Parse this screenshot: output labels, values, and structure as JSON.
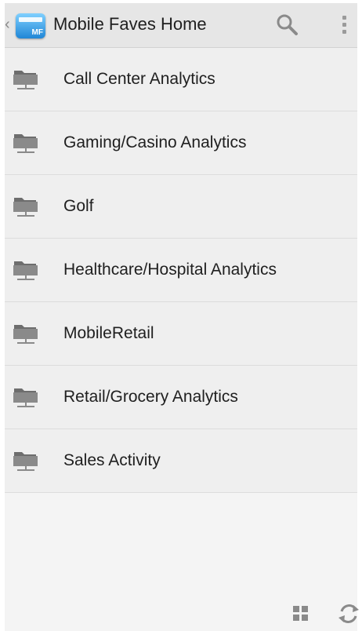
{
  "header": {
    "title": "Mobile Faves Home",
    "app_icon_text": "MF",
    "back_icon": "chevron-left-icon",
    "search_icon": "search-icon",
    "overflow_icon": "more-vert-icon"
  },
  "list": {
    "items": [
      {
        "label": "Call Center Analytics",
        "icon": "network-folder-icon"
      },
      {
        "label": "Gaming/Casino Analytics",
        "icon": "network-folder-icon"
      },
      {
        "label": "Golf",
        "icon": "network-folder-icon"
      },
      {
        "label": "Healthcare/Hospital Analytics",
        "icon": "network-folder-icon"
      },
      {
        "label": "MobileRetail",
        "icon": "network-folder-icon"
      },
      {
        "label": "Retail/Grocery Analytics",
        "icon": "network-folder-icon"
      },
      {
        "label": "Sales Activity",
        "icon": "network-folder-icon"
      }
    ]
  },
  "footer": {
    "grid_icon": "grid-view-icon",
    "refresh_icon": "refresh-icon"
  },
  "colors": {
    "actionbar": "#e6e6e6",
    "list_bg": "#efefef",
    "icon_gray": "#8a8a8a",
    "app_icon_blue": "#1f86d6"
  }
}
